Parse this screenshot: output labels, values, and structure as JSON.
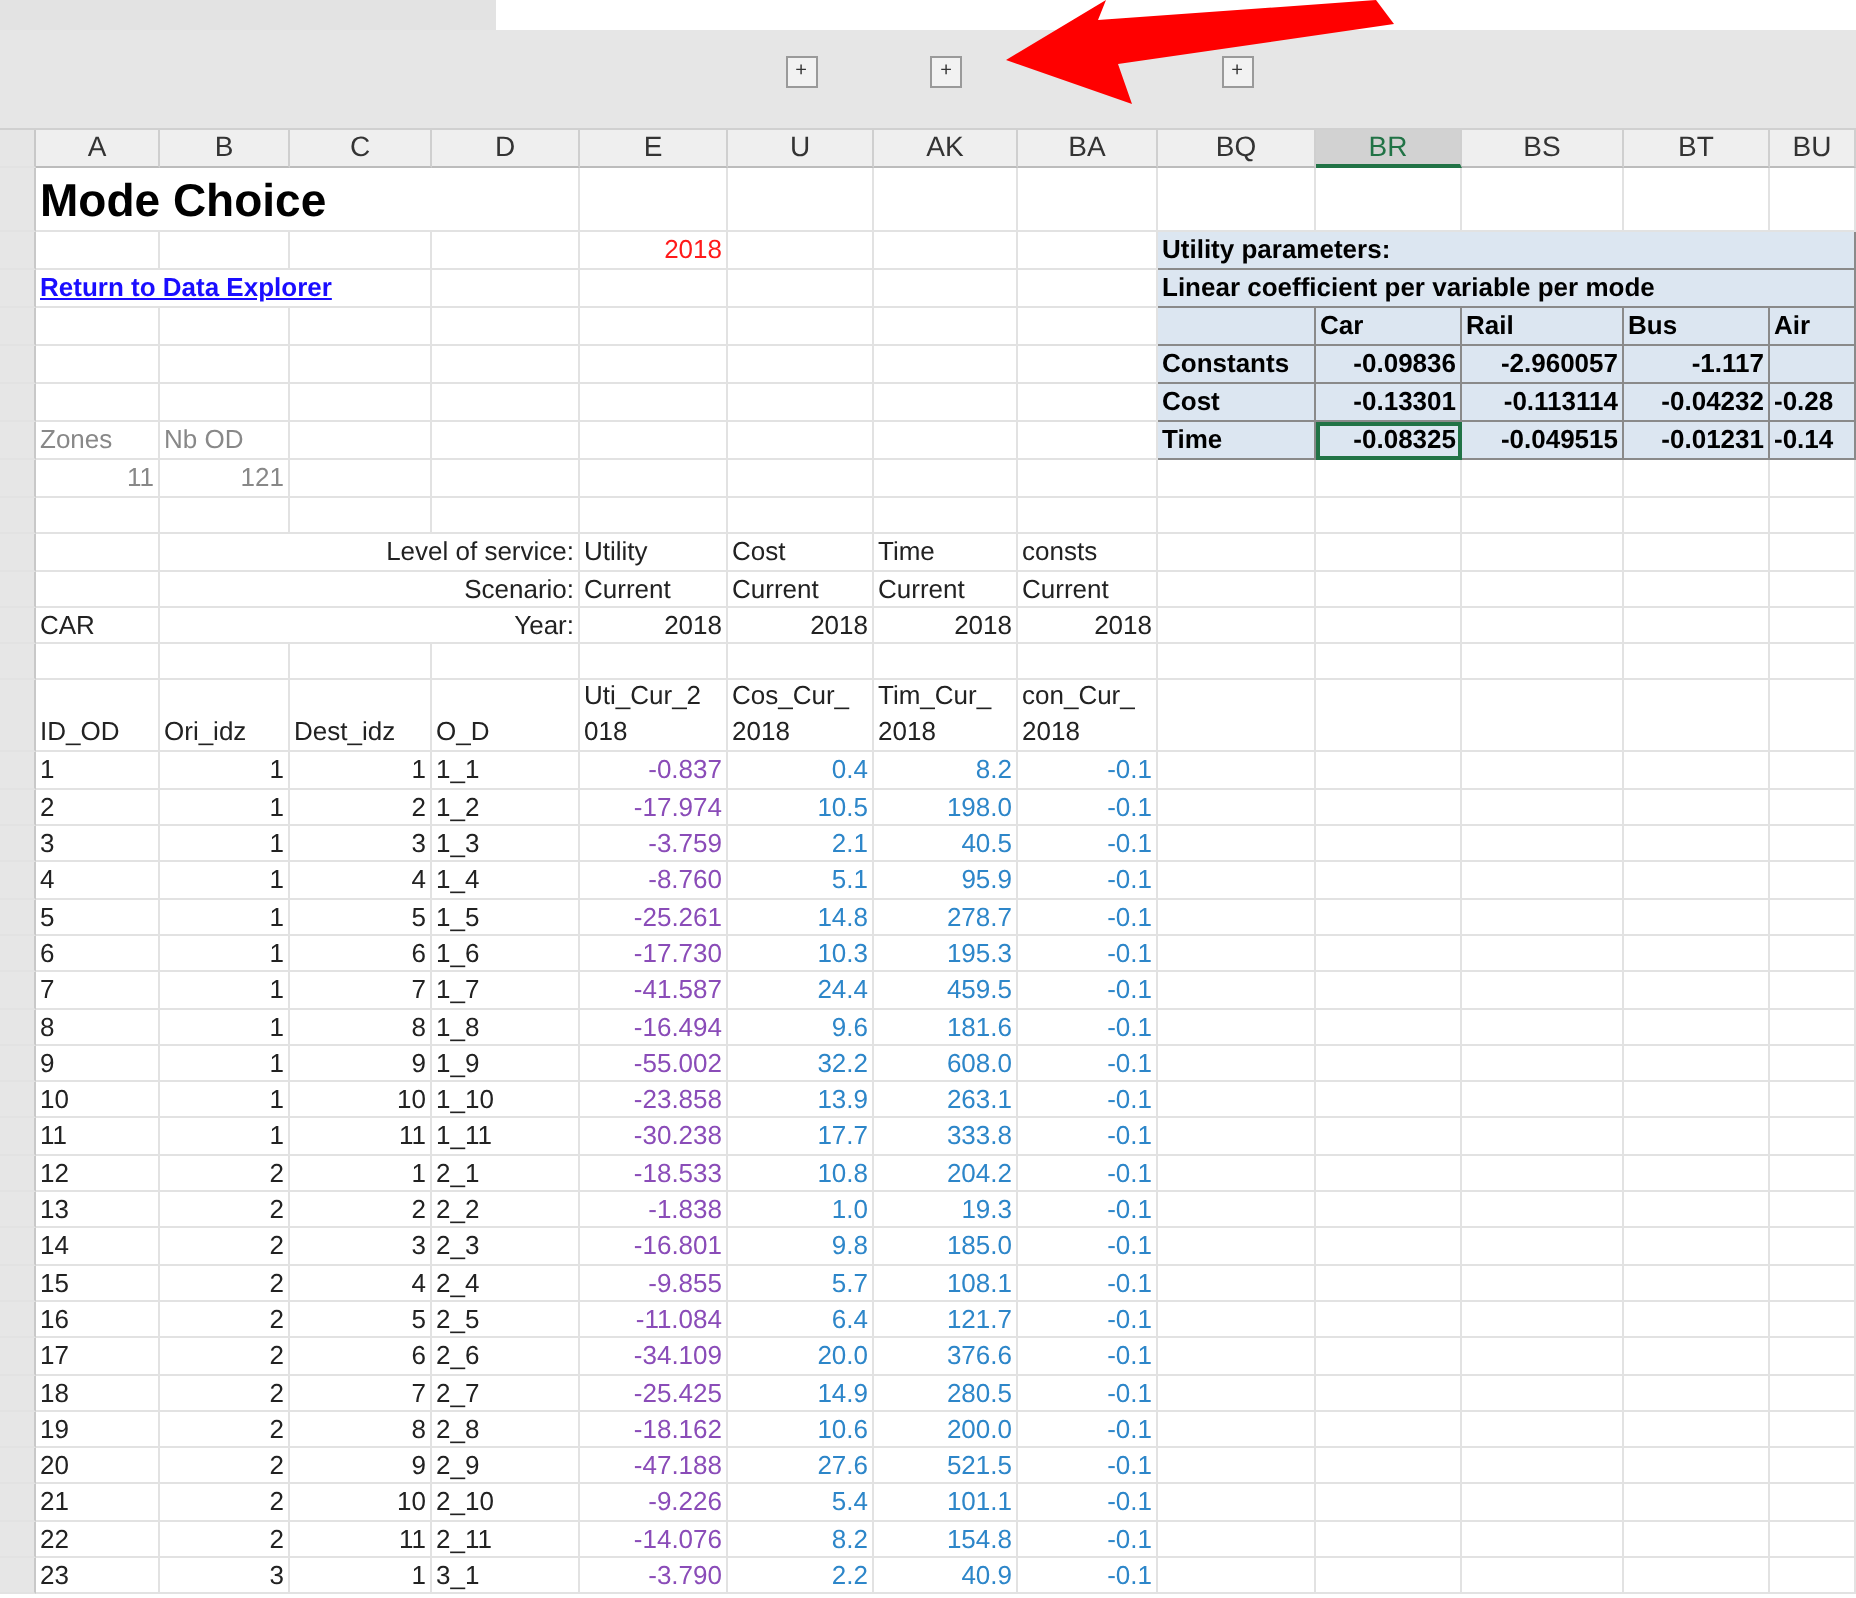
{
  "columns": [
    {
      "label": "A",
      "selected": false
    },
    {
      "label": "B",
      "selected": false
    },
    {
      "label": "C",
      "selected": false
    },
    {
      "label": "D",
      "selected": false
    },
    {
      "label": "E",
      "selected": false
    },
    {
      "label": "U",
      "selected": false,
      "group_toggle": "+"
    },
    {
      "label": "AK",
      "selected": false,
      "group_toggle": "+"
    },
    {
      "label": "BA",
      "selected": false
    },
    {
      "label": "BQ",
      "selected": false,
      "group_toggle": "+"
    },
    {
      "label": "BR",
      "selected": true
    },
    {
      "label": "BS",
      "selected": false
    },
    {
      "label": "BT",
      "selected": false
    },
    {
      "label": "BU",
      "selected": false
    }
  ],
  "title": "Mode Choice",
  "year": "2018",
  "link": "Return to Data Explorer",
  "summary": {
    "labels": [
      "Zones",
      "Nb OD"
    ],
    "values": [
      "11",
      "121"
    ]
  },
  "service": [
    {
      "label": "Level of service:",
      "values": [
        "Utility",
        "Cost",
        "Time",
        "consts"
      ]
    },
    {
      "label": "Scenario:",
      "values": [
        "Current",
        "Current",
        "Current",
        "Current"
      ]
    },
    {
      "mode": "CAR",
      "label": "Year:",
      "values": [
        "2018",
        "2018",
        "2018",
        "2018"
      ]
    }
  ],
  "table": {
    "columns": [
      "ID_OD",
      "Ori_idz",
      "Dest_idz",
      "O_D",
      "Uti_Cur_2018",
      "Cos_Cur_2018",
      "Tim_Cur_2018",
      "con_Cur_2018"
    ],
    "rows": [
      [
        "1",
        "1",
        "1",
        "1_1",
        "-0.837",
        "0.4",
        "8.2",
        "-0.1"
      ],
      [
        "2",
        "1",
        "2",
        "1_2",
        "-17.974",
        "10.5",
        "198.0",
        "-0.1"
      ],
      [
        "3",
        "1",
        "3",
        "1_3",
        "-3.759",
        "2.1",
        "40.5",
        "-0.1"
      ],
      [
        "4",
        "1",
        "4",
        "1_4",
        "-8.760",
        "5.1",
        "95.9",
        "-0.1"
      ],
      [
        "5",
        "1",
        "5",
        "1_5",
        "-25.261",
        "14.8",
        "278.7",
        "-0.1"
      ],
      [
        "6",
        "1",
        "6",
        "1_6",
        "-17.730",
        "10.3",
        "195.3",
        "-0.1"
      ],
      [
        "7",
        "1",
        "7",
        "1_7",
        "-41.587",
        "24.4",
        "459.5",
        "-0.1"
      ],
      [
        "8",
        "1",
        "8",
        "1_8",
        "-16.494",
        "9.6",
        "181.6",
        "-0.1"
      ],
      [
        "9",
        "1",
        "9",
        "1_9",
        "-55.002",
        "32.2",
        "608.0",
        "-0.1"
      ],
      [
        "10",
        "1",
        "10",
        "1_10",
        "-23.858",
        "13.9",
        "263.1",
        "-0.1"
      ],
      [
        "11",
        "1",
        "11",
        "1_11",
        "-30.238",
        "17.7",
        "333.8",
        "-0.1"
      ],
      [
        "12",
        "2",
        "1",
        "2_1",
        "-18.533",
        "10.8",
        "204.2",
        "-0.1"
      ],
      [
        "13",
        "2",
        "2",
        "2_2",
        "-1.838",
        "1.0",
        "19.3",
        "-0.1"
      ],
      [
        "14",
        "2",
        "3",
        "2_3",
        "-16.801",
        "9.8",
        "185.0",
        "-0.1"
      ],
      [
        "15",
        "2",
        "4",
        "2_4",
        "-9.855",
        "5.7",
        "108.1",
        "-0.1"
      ],
      [
        "16",
        "2",
        "5",
        "2_5",
        "-11.084",
        "6.4",
        "121.7",
        "-0.1"
      ],
      [
        "17",
        "2",
        "6",
        "2_6",
        "-34.109",
        "20.0",
        "376.6",
        "-0.1"
      ],
      [
        "18",
        "2",
        "7",
        "2_7",
        "-25.425",
        "14.9",
        "280.5",
        "-0.1"
      ],
      [
        "19",
        "2",
        "8",
        "2_8",
        "-18.162",
        "10.6",
        "200.0",
        "-0.1"
      ],
      [
        "20",
        "2",
        "9",
        "2_9",
        "-47.188",
        "27.6",
        "521.5",
        "-0.1"
      ],
      [
        "21",
        "2",
        "10",
        "2_10",
        "-9.226",
        "5.4",
        "101.1",
        "-0.1"
      ],
      [
        "22",
        "2",
        "11",
        "2_11",
        "-14.076",
        "8.2",
        "154.8",
        "-0.1"
      ],
      [
        "23",
        "3",
        "1",
        "3_1",
        "-3.790",
        "2.2",
        "40.9",
        "-0.1"
      ]
    ]
  },
  "parameters": {
    "title": "Utility parameters:",
    "subtitle": "Linear coefficient per variable per mode",
    "modes": [
      "Car",
      "Rail",
      "Bus",
      "Air"
    ],
    "rows": [
      {
        "name": "Constants",
        "cells": [
          {
            "text": "-0.09836",
            "selected": false
          },
          {
            "text": "-2.960057",
            "selected": false
          },
          {
            "text": "-1.117",
            "selected": false
          }
        ]
      },
      {
        "name": "Cost",
        "cells": [
          {
            "text": "-0.13301",
            "selected": false
          },
          {
            "text": "-0.113114",
            "selected": false
          },
          {
            "text": "-0.04232",
            "selected": false
          },
          {
            "text": "-0.28",
            "selected": false
          }
        ]
      },
      {
        "name": "Time",
        "cells": [
          {
            "text": "-0.08325",
            "selected": true
          },
          {
            "text": "-0.049515",
            "selected": false
          },
          {
            "text": "-0.01231",
            "selected": false
          },
          {
            "text": "-0.14",
            "selected": false
          }
        ]
      }
    ]
  }
}
